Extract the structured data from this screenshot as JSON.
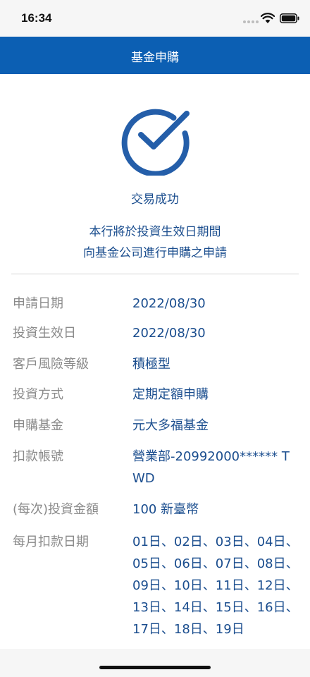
{
  "status_bar": {
    "time": "16:34"
  },
  "icons": {
    "wifi": "wifi-icon",
    "battery": "battery-icon",
    "success": "check-circle-icon"
  },
  "colors": {
    "nav_bar": "#0c5fb3",
    "value_text": "#1a4d8e",
    "label_text": "#8a8a8a"
  },
  "header": {
    "title": "基金申購"
  },
  "result": {
    "title": "交易成功",
    "message_line1": "本行將於投資生效日期間",
    "message_line2": "向基金公司進行申購之申請"
  },
  "details": [
    {
      "label": "申請日期",
      "value": "2022/08/30"
    },
    {
      "label": "投資生效日",
      "value": "2022/08/30"
    },
    {
      "label": "客戶風險等級",
      "value": "積極型"
    },
    {
      "label": "投資方式",
      "value": "定期定額申購"
    },
    {
      "label": "申購基金",
      "value": "元大多福基金"
    },
    {
      "label": "扣款帳號",
      "value": "營業部-20992000****** TWD"
    },
    {
      "label": "(每次)投資金額",
      "value": "100  新臺幣"
    },
    {
      "label": "每月扣款日期",
      "value": "01日、02日、03日、04日、05日、06日、07日、08日、09日、10日、11日、12日、13日、14日、15日、16日、17日、18日、19日"
    }
  ]
}
